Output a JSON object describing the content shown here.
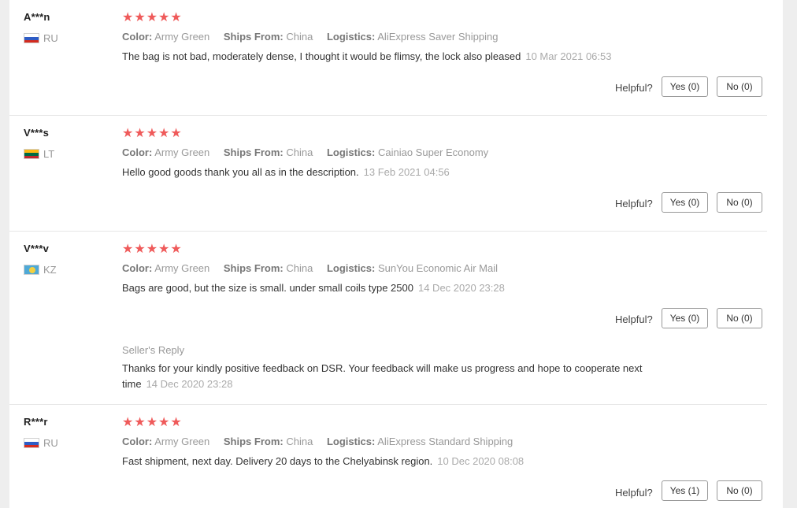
{
  "reviews": [
    {
      "user": "A***n",
      "country": "RU",
      "stars": "★★★★★",
      "color_label": "Color:",
      "color": "Army Green",
      "ships_label": "Ships From:",
      "ships": "China",
      "logistics_label": "Logistics:",
      "logistics": "AliExpress Saver Shipping",
      "text": "The bag is not bad, moderately dense, I thought it would be flimsy, the lock also pleased",
      "date": "10 Mar 2021 06:53",
      "helpful": "Helpful?",
      "yes": "Yes (0)",
      "no": "No (0)"
    },
    {
      "user": "V***s",
      "country": "LT",
      "stars": "★★★★★",
      "color_label": "Color:",
      "color": "Army Green",
      "ships_label": "Ships From:",
      "ships": "China",
      "logistics_label": "Logistics:",
      "logistics": "Cainiao Super Economy",
      "text": "Hello good goods thank you all as in the description.",
      "date": "13 Feb 2021 04:56",
      "helpful": "Helpful?",
      "yes": "Yes (0)",
      "no": "No (0)"
    },
    {
      "user": "V***v",
      "country": "KZ",
      "stars": "★★★★★",
      "color_label": "Color:",
      "color": "Army Green",
      "ships_label": "Ships From:",
      "ships": "China",
      "logistics_label": "Logistics:",
      "logistics": "SunYou Economic Air Mail",
      "text": "Bags are good, but the size is small. under small coils type 2500",
      "date": "14 Dec 2020 23:28",
      "helpful": "Helpful?",
      "yes": "Yes (0)",
      "no": "No (0)",
      "reply_title": "Seller's Reply",
      "reply_text": "Thanks for your kindly positive feedback on DSR. Your feedback will make us progress and hope to cooperate next time",
      "reply_date": "14 Dec 2020 23:28"
    },
    {
      "user": "R***r",
      "country": "RU",
      "stars": "★★★★★",
      "color_label": "Color:",
      "color": "Army Green",
      "ships_label": "Ships From:",
      "ships": "China",
      "logistics_label": "Logistics:",
      "logistics": "AliExpress Standard Shipping",
      "text": "Fast shipment, next day. Delivery 20 days to the Chelyabinsk region.",
      "date": "10 Dec 2020 08:08",
      "helpful": "Helpful?",
      "yes": "Yes (1)",
      "no": "No (0)"
    }
  ],
  "colors": {
    "star": "#ef5a5a",
    "muted_text": "#999999",
    "body_text": "#333333",
    "divider": "#e6e6e6"
  }
}
